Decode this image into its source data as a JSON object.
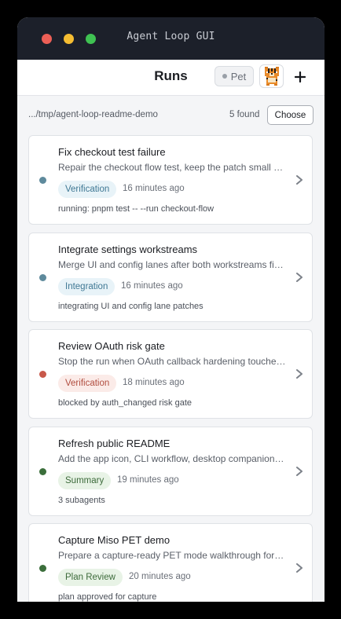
{
  "window": {
    "title": "Agent Loop GUI"
  },
  "header": {
    "title": "Runs",
    "pet_label": "Pet",
    "avatar_icon": "tiger-pixel-avatar",
    "add_icon": "plus-icon"
  },
  "pathbar": {
    "path": ".../tmp/agent-loop-readme-demo",
    "found": "5 found",
    "choose_label": "Choose"
  },
  "colors": {
    "status_active": "#5e8a9c",
    "status_blocked": "#c8584a",
    "status_done": "#3b6e3b",
    "badge_blue_bg": "#e8f3f8",
    "badge_blue_fg": "#3f7894",
    "badge_red_bg": "#fbebe8",
    "badge_red_fg": "#b14d3f",
    "badge_green_bg": "#e8f3e6",
    "badge_green_fg": "#3d6b3b"
  },
  "runs": [
    {
      "title": "Fix checkout test failure",
      "description": "Repair the checkout flow test, keep the patch small and verify it",
      "badge": "Verification",
      "badge_tone": "blue",
      "status": "active",
      "time": "16 minutes ago",
      "detail": "running: pnpm test -- --run checkout-flow"
    },
    {
      "title": "Integrate settings workstreams",
      "description": "Merge UI and config lanes after both workstreams finish",
      "badge": "Integration",
      "badge_tone": "blue",
      "status": "active",
      "time": "16 minutes ago",
      "detail": "integrating UI and config lane patches"
    },
    {
      "title": "Review OAuth risk gate",
      "description": "Stop the run when OAuth callback hardening touches auth code",
      "badge": "Verification",
      "badge_tone": "red",
      "status": "blocked",
      "time": "18 minutes ago",
      "detail": "blocked by auth_changed risk gate"
    },
    {
      "title": "Refresh public README",
      "description": "Add the app icon, CLI workflow, desktop companion notes",
      "badge": "Summary",
      "badge_tone": "green",
      "status": "done",
      "time": "19 minutes ago",
      "detail": "3 subagents"
    },
    {
      "title": "Capture Miso PET demo",
      "description": "Prepare a capture-ready PET mode walkthrough for the demo",
      "badge": "Plan Review",
      "badge_tone": "green",
      "status": "done",
      "time": "20 minutes ago",
      "detail": "plan approved for capture"
    }
  ]
}
